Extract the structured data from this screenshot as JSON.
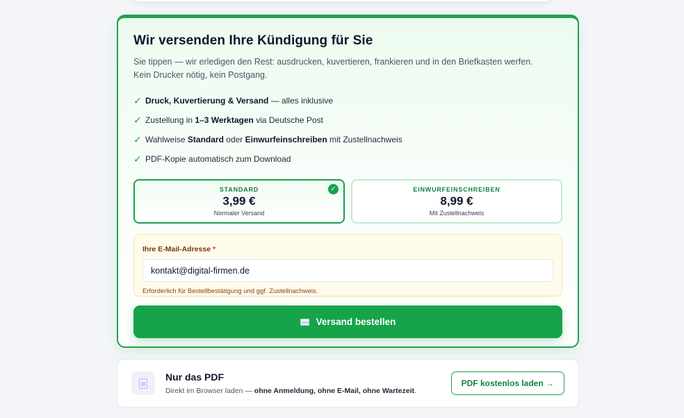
{
  "ship": {
    "title": "Wir versenden Ihre Kündigung für Sie",
    "subtitle": "Sie tippen — wir erledigen den Rest: ausdrucken, kuvertieren, frankieren und in den Briefkasten werfen. Kein Drucker nötig, kein Postgang.",
    "features": [
      {
        "parts": [
          "",
          "Druck, Kuvertierung & Versand",
          " — alles inklusive"
        ]
      },
      {
        "parts": [
          "Zustellung in ",
          "1–3 Werktagen",
          " via Deutsche Post"
        ]
      },
      {
        "parts": [
          "Wahlweise ",
          "Standard",
          " oder "
        ],
        "bold2": "Einwurfeinschreiben",
        "tail": " mit Zustellnachweis"
      },
      {
        "parts": [
          "PDF-Kopie automatisch zum Download",
          "",
          ""
        ]
      }
    ],
    "check_char": "✓",
    "options": [
      {
        "label": "STANDARD",
        "price": "3,99 €",
        "desc": "Normaler Versand",
        "selected": true
      },
      {
        "label": "EINWURFEINSCHREIBEN",
        "price": "8,99 €",
        "desc": "Mit Zustellnachweis",
        "selected": false
      }
    ],
    "selected_check": "✓",
    "email": {
      "label": "Ihre E-Mail-Adresse",
      "required": "*",
      "value": "kontakt@digital-firmen.de",
      "hint": "Erforderlich für Bestellbestätigung und ggf. Zustellnachweis."
    },
    "order_button": "Versand bestellen"
  },
  "pdf": {
    "title": "Nur das PDF",
    "desc_prefix": "Direkt im Browser laden — ",
    "desc_bold": "ohne Anmeldung, ohne E-Mail, ohne Wartezeit",
    "desc_suffix": ".",
    "button": "PDF kostenlos laden →"
  },
  "colors": {
    "accent": "#16a34a",
    "background": "#f3f5f8",
    "email_bg": "#fffbeb"
  },
  "icons": {
    "check": "check-icon",
    "envelope": "envelope-icon",
    "document": "document-icon"
  }
}
